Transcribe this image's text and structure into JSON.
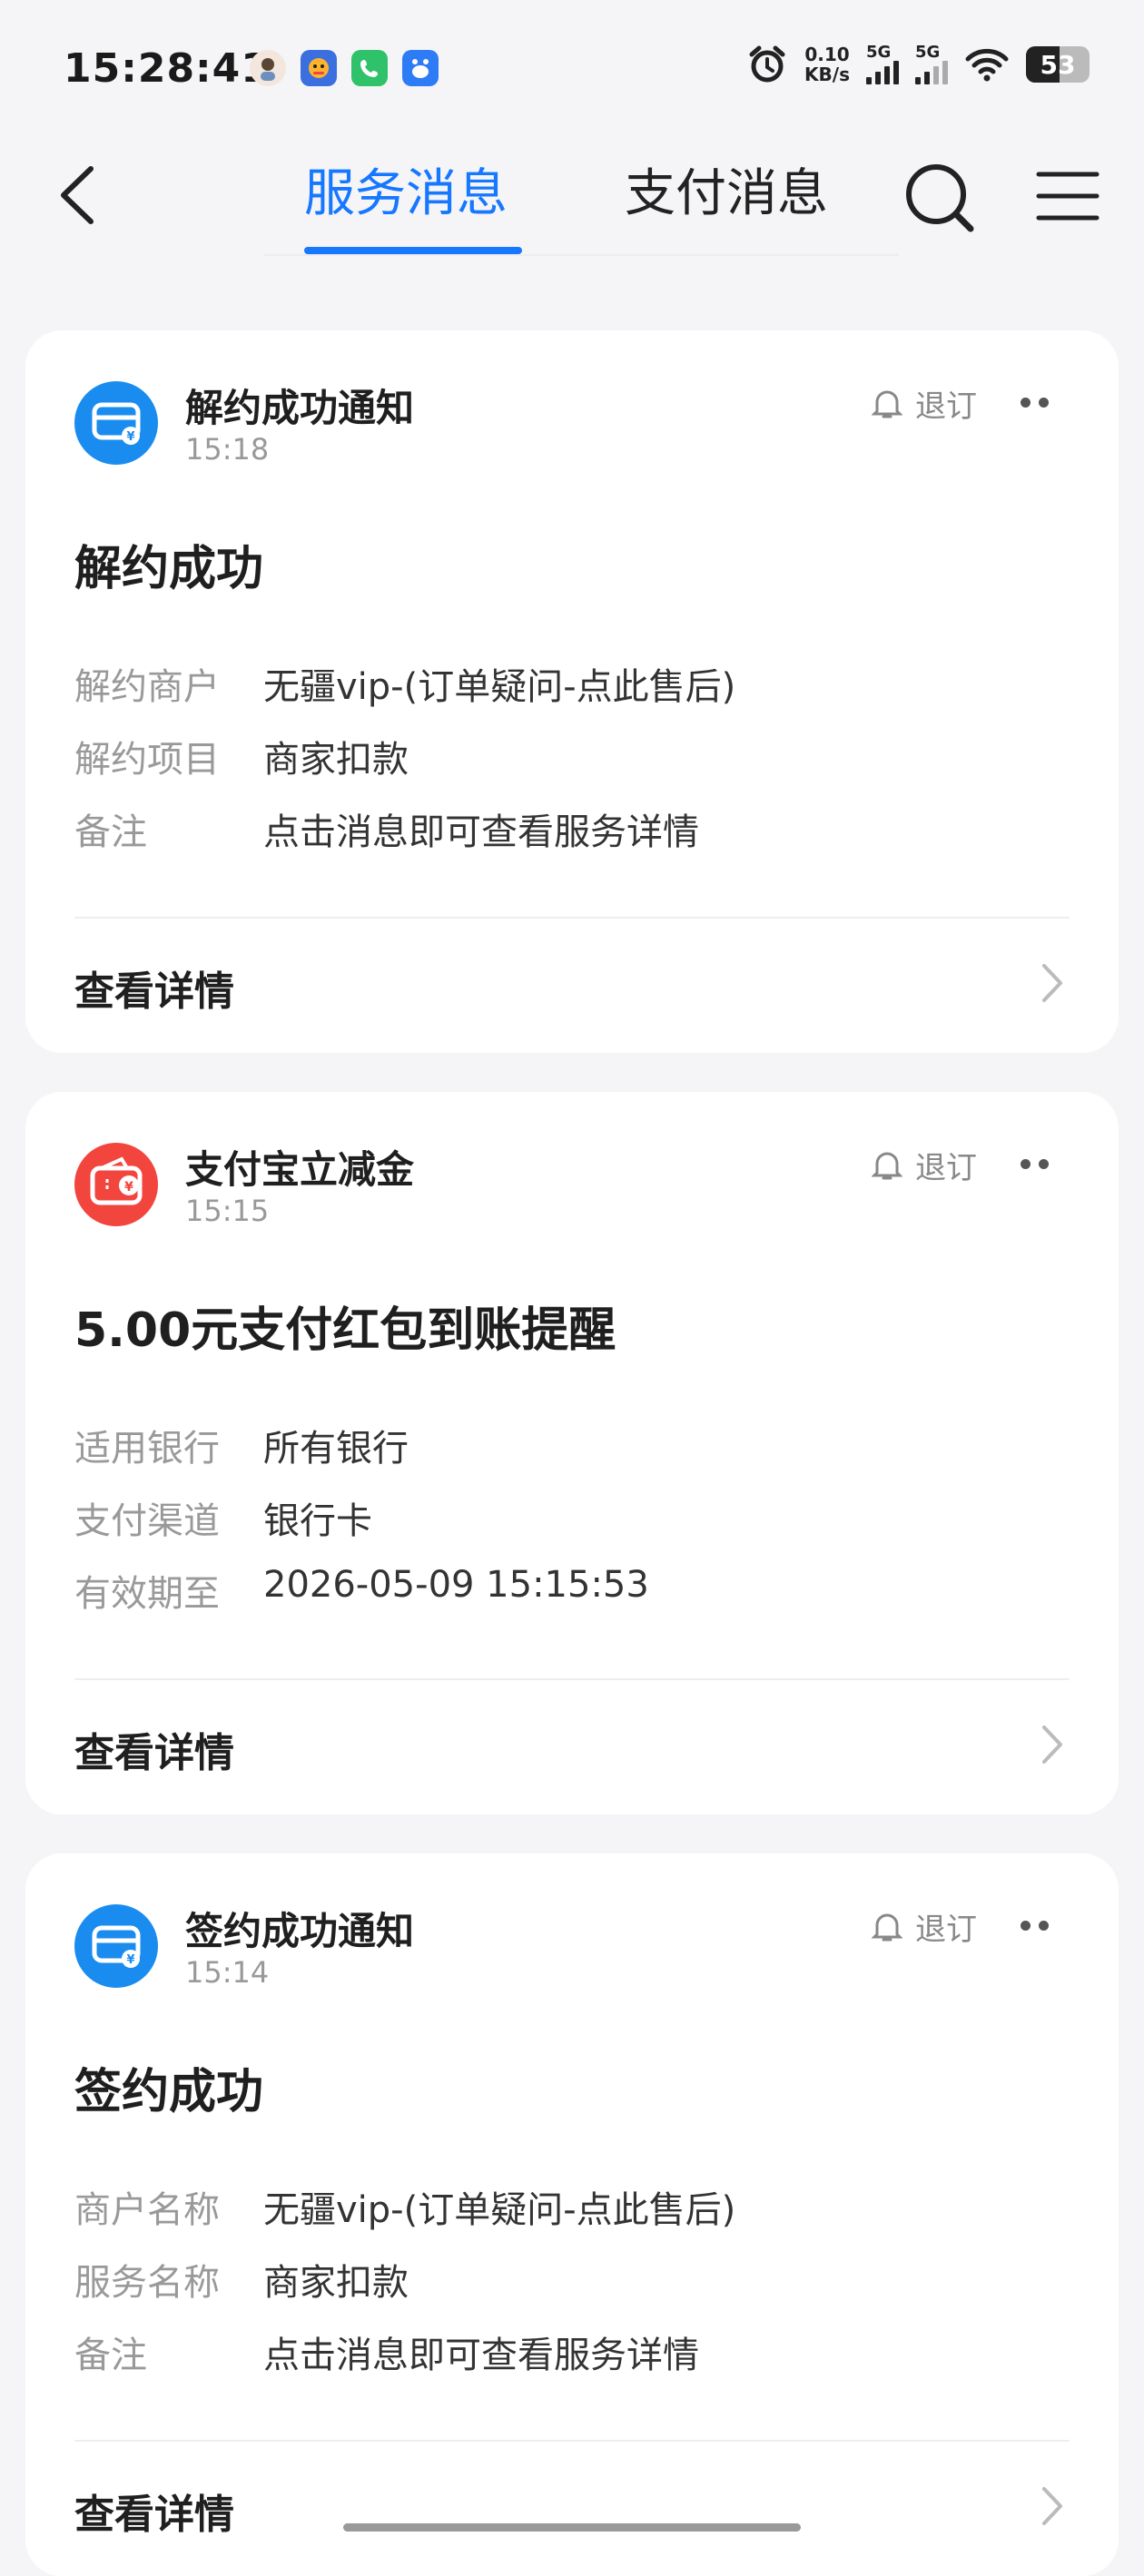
{
  "status_bar": {
    "time": "15:28:41",
    "net_speed_value": "0.10",
    "net_speed_unit": "KB/s",
    "signal1_label": "5G",
    "signal2_label": "5G",
    "battery": "53"
  },
  "nav": {
    "tab_service": "服务消息",
    "tab_payment": "支付消息"
  },
  "cards": [
    {
      "icon": "service-ticket-icon",
      "title": "解约成功通知",
      "time": "15:18",
      "unsubscribe": "退订",
      "headline": "解约成功",
      "rows": [
        {
          "label": "解约商户",
          "value": "无疆vip-(订单疑问-点此售后)"
        },
        {
          "label": "解约项目",
          "value": "商家扣款"
        },
        {
          "label": "备注",
          "value": "点击消息即可查看服务详情"
        }
      ],
      "detail": "查看详情"
    },
    {
      "icon": "red-wallet-icon",
      "title": "支付宝立减金",
      "time": "15:15",
      "unsubscribe": "退订",
      "headline": "5.00元支付红包到账提醒",
      "rows": [
        {
          "label": "适用银行",
          "value": "所有银行"
        },
        {
          "label": "支付渠道",
          "value": "银行卡"
        },
        {
          "label": "有效期至",
          "value": "2026-05-09 15:15:53"
        }
      ],
      "detail": "查看详情"
    },
    {
      "icon": "service-ticket-icon",
      "title": "签约成功通知",
      "time": "15:14",
      "unsubscribe": "退订",
      "headline": "签约成功",
      "rows": [
        {
          "label": "商户名称",
          "value": "无疆vip-(订单疑问-点此售后)"
        },
        {
          "label": "服务名称",
          "value": "商家扣款"
        },
        {
          "label": "备注",
          "value": "点击消息即可查看服务详情"
        }
      ],
      "detail": "查看详情"
    }
  ],
  "colors": {
    "accent": "#1677ff",
    "service_icon_bg": "#1a8cf0",
    "wallet_icon_bg": "#f2453d"
  }
}
